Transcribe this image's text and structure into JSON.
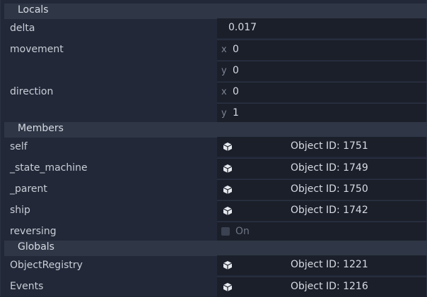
{
  "sections": {
    "locals": "Locals",
    "members": "Members",
    "globals": "Globals"
  },
  "locals": {
    "delta": {
      "label": "delta",
      "value": "0.017"
    },
    "movement": {
      "label": "movement",
      "x_axis": "x",
      "x": "0",
      "y_axis": "y",
      "y": "0"
    },
    "direction": {
      "label": "direction",
      "x_axis": "x",
      "x": "0",
      "y_axis": "y",
      "y": "1"
    }
  },
  "members": {
    "self": {
      "label": "self",
      "value": "Object ID: 1751"
    },
    "state_machine": {
      "label": "_state_machine",
      "value": "Object ID: 1749"
    },
    "parent": {
      "label": "_parent",
      "value": "Object ID: 1750"
    },
    "ship": {
      "label": "ship",
      "value": "Object ID: 1742"
    },
    "reversing": {
      "label": "reversing",
      "value": "On",
      "checked": false
    }
  },
  "globals": {
    "object_registry": {
      "label": "ObjectRegistry",
      "value": "Object ID: 1221"
    },
    "events": {
      "label": "Events",
      "value": "Object ID: 1216"
    }
  },
  "colors": {
    "background": "#222838",
    "section": "#2f3646",
    "field": "#1b1f2a",
    "text": "#d7dbe2"
  }
}
